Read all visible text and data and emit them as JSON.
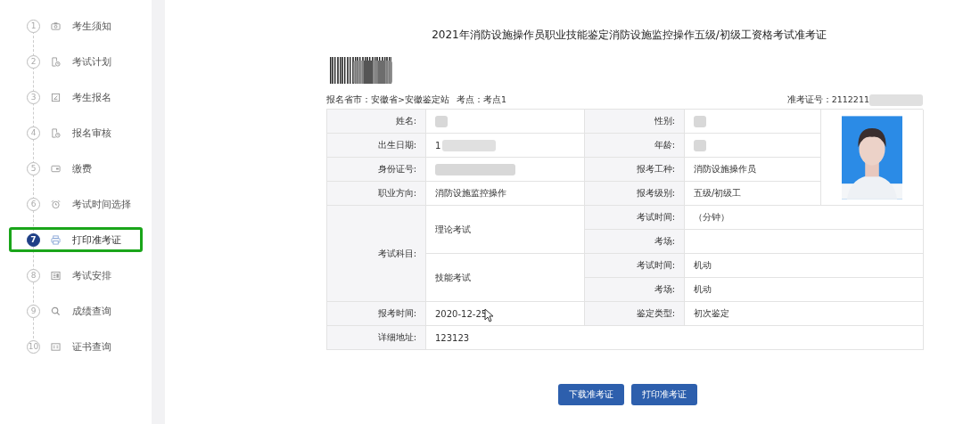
{
  "steps": [
    {
      "number": "1",
      "label": "考生须知",
      "selected": false
    },
    {
      "number": "2",
      "label": "考试计划",
      "selected": false
    },
    {
      "number": "3",
      "label": "考生报名",
      "selected": false
    },
    {
      "number": "4",
      "label": "报名审核",
      "selected": false
    },
    {
      "number": "5",
      "label": "缴费",
      "selected": false
    },
    {
      "number": "6",
      "label": "考试时间选择",
      "selected": false
    },
    {
      "number": "7",
      "label": "打印准考证",
      "selected": true
    },
    {
      "number": "8",
      "label": "考试安排",
      "selected": false
    },
    {
      "number": "9",
      "label": "成绩查询",
      "selected": false
    },
    {
      "number": "10",
      "label": "证书查询",
      "selected": false
    }
  ],
  "ticket": {
    "title": "2021年消防设施操作员职业技能鉴定消防设施监控操作五级/初级工资格考试准考证",
    "meta": {
      "region_label": "报名省市：",
      "region": "安徽省>安徽鉴定站",
      "site_label": "考点：",
      "site": "考点1",
      "number_label": "准考证号：",
      "number": "2112211",
      "number_redacted": true
    },
    "info_rows": [
      {
        "cells": [
          {
            "label": "姓名:",
            "redacted": true
          },
          {
            "label": "性别:",
            "redacted": true
          }
        ]
      },
      {
        "cells": [
          {
            "label": "出生日期:",
            "value": "1",
            "redacted": true
          },
          {
            "label": "年龄:",
            "redacted": true
          }
        ]
      },
      {
        "cells": [
          {
            "label": "身份证号:",
            "redacted": true
          },
          {
            "label": "报考工种:",
            "value": "消防设施操作员",
            "redacted": false
          }
        ]
      },
      {
        "cells": [
          {
            "label": "职业方向:",
            "value": "消防设施监控操作",
            "redacted": false
          },
          {
            "label": "报考级别:",
            "value": "五级/初级工",
            "redacted": false
          }
        ]
      }
    ],
    "subjects_label": "考试科目:",
    "subjects": [
      {
        "name": "理论考试",
        "details": [
          {
            "label": "考试时间:",
            "value": "（分钟）"
          },
          {
            "label": "考场:"
          }
        ]
      },
      {
        "name": "技能考试",
        "details": [
          {
            "label": "考试时间:",
            "value": "机动"
          },
          {
            "label": "考场:",
            "value": "机动"
          }
        ]
      }
    ],
    "bottom_rows": [
      {
        "cells": [
          {
            "label": "报考时间:",
            "value": "2020-12-25"
          },
          {
            "label": "鉴定类型:",
            "value": "初次鉴定"
          }
        ]
      },
      {
        "cells": [
          {
            "label": "详细地址:",
            "value": "123123"
          }
        ]
      }
    ]
  },
  "buttons": [
    "下载准考证",
    "打印准考证"
  ]
}
